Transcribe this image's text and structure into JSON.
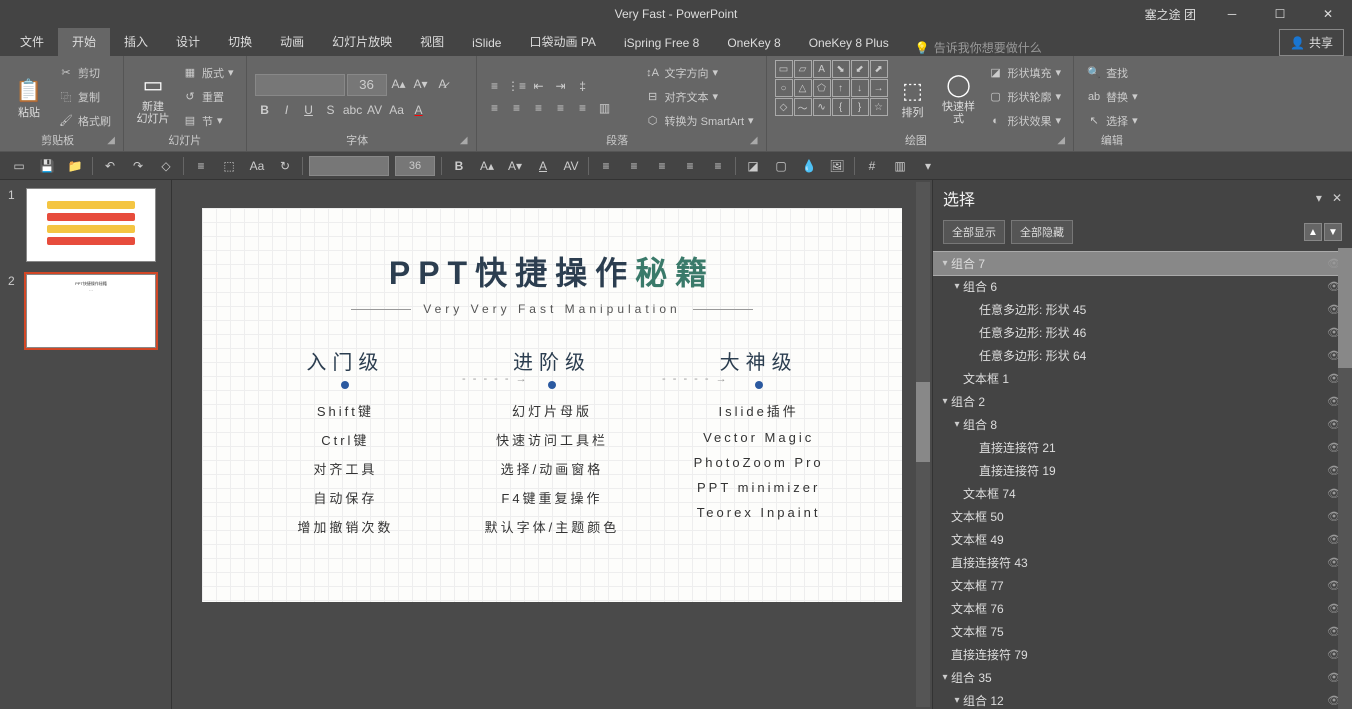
{
  "titlebar": {
    "title": "Very Fast  -  PowerPoint",
    "user": "塞之途  团"
  },
  "menu": {
    "tabs": [
      "文件",
      "开始",
      "插入",
      "设计",
      "切换",
      "动画",
      "幻灯片放映",
      "视图",
      "iSlide",
      "口袋动画 PA",
      "iSpring Free 8",
      "OneKey 8",
      "OneKey 8 Plus"
    ],
    "tellme": "告诉我你想要做什么",
    "share": "共享"
  },
  "ribbon": {
    "clipboard": {
      "paste": "粘贴",
      "cut": "剪切",
      "copy": "复制",
      "format_painter": "格式刷",
      "label": "剪贴板"
    },
    "slides": {
      "new_slide": "新建\n幻灯片",
      "layout": "版式",
      "reset": "重置",
      "section": "节",
      "label": "幻灯片"
    },
    "font": {
      "size": "36",
      "label": "字体"
    },
    "paragraph": {
      "label": "段落",
      "text_dir": "文字方向",
      "align_text": "对齐文本",
      "smartart": "转换为 SmartArt"
    },
    "drawing": {
      "arrange": "排列",
      "quick_styles": "快速样式",
      "fill": "形状填充",
      "outline": "形状轮廓",
      "effects": "形状效果",
      "label": "绘图"
    },
    "editing": {
      "find": "查找",
      "replace": "替换",
      "select": "选择",
      "label": "编辑"
    }
  },
  "qat": {
    "fontsize": "36"
  },
  "slide": {
    "title_a": "PPT快捷操作",
    "title_b": "秘籍",
    "subtitle": "Very Very Fast Manipulation",
    "levels": [
      {
        "title": "入门级",
        "items": [
          "Shift键",
          "Ctrl键",
          "对齐工具",
          "自动保存",
          "增加撤销次数"
        ]
      },
      {
        "title": "进阶级",
        "items": [
          "幻灯片母版",
          "快速访问工具栏",
          "选择/动画窗格",
          "F4键重复操作",
          "默认字体/主题颜色"
        ]
      },
      {
        "title": "大神级",
        "items": [
          "Islide插件",
          "Vector Magic",
          "PhotoZoom Pro",
          "PPT minimizer",
          "Teorex Inpaint"
        ]
      }
    ]
  },
  "selpane": {
    "title": "选择",
    "show_all": "全部显示",
    "hide_all": "全部隐藏",
    "tree": [
      {
        "label": "组合 7",
        "indent": 0,
        "toggle": "▾",
        "selected": true
      },
      {
        "label": "组合 6",
        "indent": 1,
        "toggle": "▾"
      },
      {
        "label": "任意多边形: 形状 45",
        "indent": 2
      },
      {
        "label": "任意多边形: 形状 46",
        "indent": 2
      },
      {
        "label": "任意多边形: 形状 64",
        "indent": 2
      },
      {
        "label": "文本框 1",
        "indent": 1
      },
      {
        "label": "组合 2",
        "indent": 0,
        "toggle": "▾"
      },
      {
        "label": "组合 8",
        "indent": 1,
        "toggle": "▾"
      },
      {
        "label": "直接连接符 21",
        "indent": 2
      },
      {
        "label": "直接连接符 19",
        "indent": 2
      },
      {
        "label": "文本框 74",
        "indent": 1
      },
      {
        "label": "文本框 50",
        "indent": 0
      },
      {
        "label": "文本框 49",
        "indent": 0
      },
      {
        "label": "直接连接符 43",
        "indent": 0
      },
      {
        "label": "文本框 77",
        "indent": 0
      },
      {
        "label": "文本框 76",
        "indent": 0
      },
      {
        "label": "文本框 75",
        "indent": 0
      },
      {
        "label": "直接连接符 79",
        "indent": 0
      },
      {
        "label": "组合 35",
        "indent": 0,
        "toggle": "▾"
      },
      {
        "label": "组合 12",
        "indent": 1,
        "toggle": "▾"
      }
    ]
  }
}
